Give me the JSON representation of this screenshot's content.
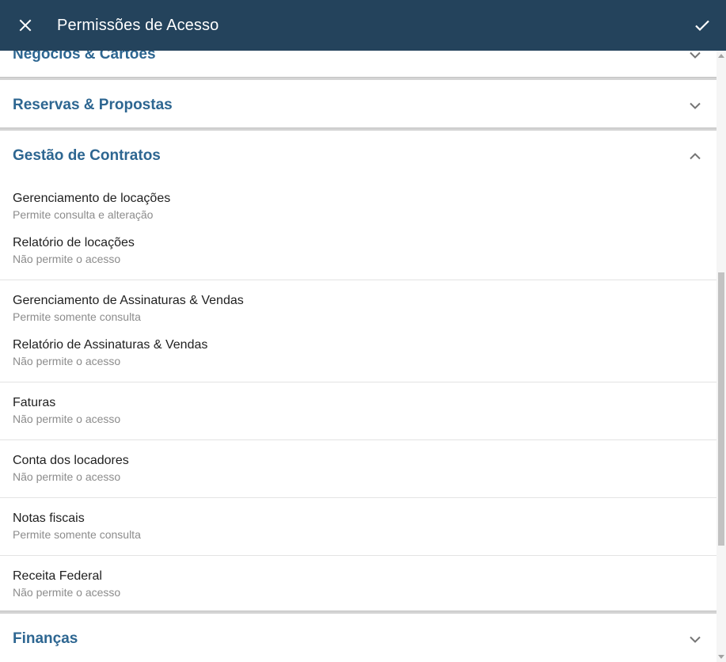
{
  "appbar": {
    "title": "Permissões de Acesso",
    "close_icon": "close-icon",
    "confirm_icon": "check-icon",
    "background": "#24435c"
  },
  "sections": [
    {
      "title": "Negócios & Cartões",
      "expanded": false,
      "chevron": "chevron-down-icon"
    },
    {
      "title": "Reservas & Propostas",
      "expanded": false,
      "chevron": "chevron-down-icon"
    },
    {
      "title": "Gestão de Contratos",
      "expanded": true,
      "chevron": "chevron-up-icon",
      "groups": [
        [
          {
            "name": "Gerenciamento de locações",
            "permission": "Permite consulta e alteração"
          },
          {
            "name": "Relatório de locações",
            "permission": "Não permite o acesso"
          }
        ],
        [
          {
            "name": "Gerenciamento de Assinaturas & Vendas",
            "permission": "Permite somente consulta"
          },
          {
            "name": "Relatório de Assinaturas & Vendas",
            "permission": "Não permite o acesso"
          }
        ],
        [
          {
            "name": "Faturas",
            "permission": "Não permite o acesso"
          }
        ],
        [
          {
            "name": "Conta dos locadores",
            "permission": "Não permite o acesso"
          }
        ],
        [
          {
            "name": "Notas fiscais",
            "permission": "Permite somente consulta"
          }
        ],
        [
          {
            "name": "Receita Federal",
            "permission": "Não permite o acesso"
          }
        ]
      ]
    },
    {
      "title": "Finanças",
      "expanded": false,
      "chevron": "chevron-down-icon"
    }
  ],
  "colors": {
    "section_title": "#2d6691",
    "item_name": "#1f1f1f",
    "item_desc": "#8c8c8c"
  }
}
